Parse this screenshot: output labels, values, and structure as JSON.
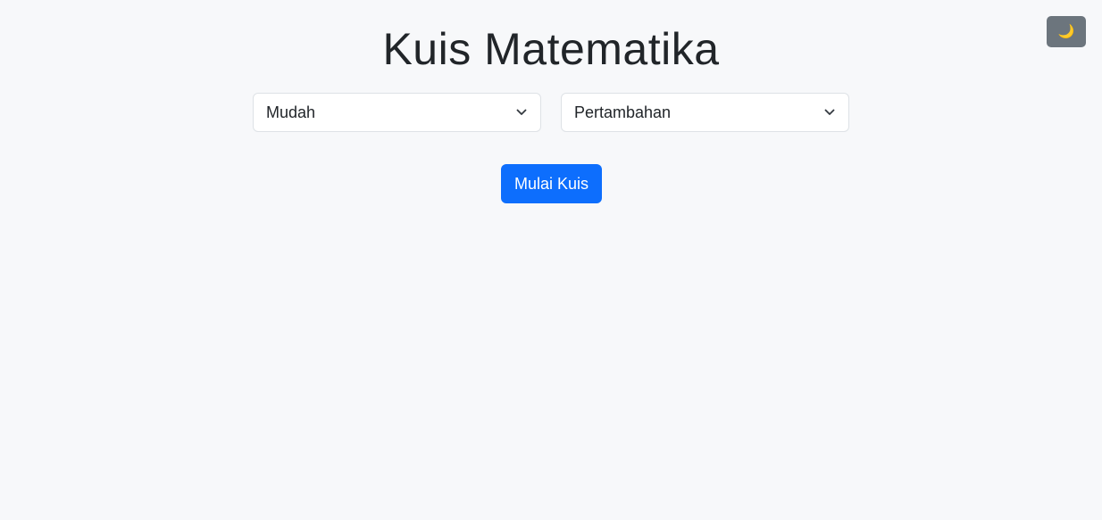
{
  "page": {
    "title": "Kuis Matematika",
    "background": "#f7f8fa"
  },
  "theme_toggle": {
    "icon": "moon-icon",
    "glyph": "🌙",
    "background": "#6c757d"
  },
  "controls": {
    "level_select": {
      "selected": "Mudah",
      "icon": "chevron-down-icon"
    },
    "operation_select": {
      "selected": "Pertambahan",
      "icon": "chevron-down-icon"
    }
  },
  "start_button": {
    "label": "Mulai Kuis",
    "color": "#0d6efd"
  }
}
